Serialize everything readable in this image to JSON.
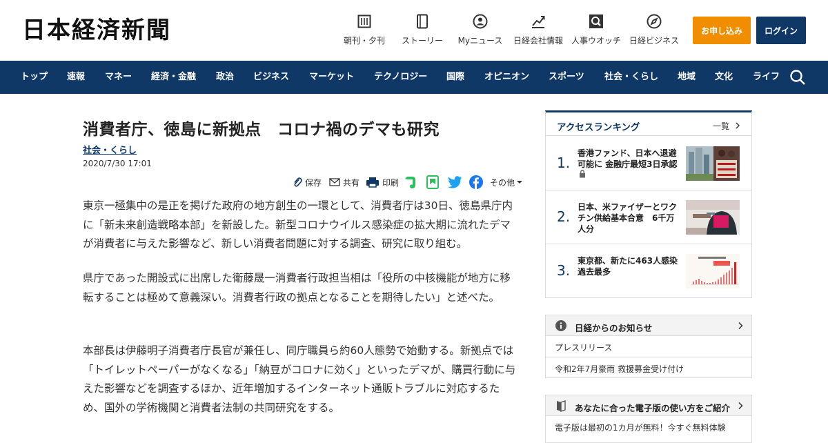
{
  "header": {
    "logo": "日本経済新聞",
    "utilities": [
      {
        "label": "朝刊・夕刊",
        "icon": "newspaper-icon"
      },
      {
        "label": "ストーリー",
        "icon": "book-icon"
      },
      {
        "label": "Myニュース",
        "icon": "user-icon"
      },
      {
        "label": "日経会社情報",
        "icon": "chart-icon"
      },
      {
        "label": "人事ウオッチ",
        "icon": "search-person-icon"
      },
      {
        "label": "日経ビジネス",
        "icon": "compass-icon"
      }
    ],
    "apply_label": "お申し込み",
    "login_label": "ログイン"
  },
  "nav": {
    "items": [
      "トップ",
      "速報",
      "マネー",
      "経済・金融",
      "政治",
      "ビジネス",
      "マーケット",
      "テクノロジー",
      "国際",
      "オピニオン",
      "スポーツ",
      "社会・くらし",
      "地域",
      "文化",
      "ライフ"
    ]
  },
  "article": {
    "title": "消費者庁、徳島に新拠点　コロナ禍のデマも研究",
    "category": "社会・くらし",
    "date": "2020/7/30 17:01",
    "share": {
      "save": "保存",
      "share": "共有",
      "print": "印刷",
      "other": "その他"
    },
    "paragraphs": [
      "東京一極集中の是正を掲げた政府の地方創生の一環として、消費者庁は30日、徳島県庁内に「新未来創造戦略本部」を新設した。新型コロナウイルス感染症の拡大期に流れたデマが消費者に与えた影響など、新しい消費者問題に対する調査、研究に取り組む。",
      "県庁であった開設式に出席した衛藤晟一消費者行政担当相は「役所の中核機能が地方に移転することは極めて意義深い。消費者行政の拠点となることを期待したい」と述べた。",
      "本部長は伊藤明子消費者庁長官が兼任し、同庁職員ら約60人態勢で始動する。新拠点では「トイレットペーパーがなくなる」「納豆がコロナに効く」といったデマが、購買行動に与えた影響などを調査するほか、近年増加するインターネット通販トラブルに対応するため、国外の学術機関と消費者法制の共同研究をする。"
    ]
  },
  "sidebar": {
    "ranking": {
      "title": "アクセスランキング",
      "more": "一覧",
      "items": [
        {
          "rank": "1.",
          "text": "香港ファンド、日本へ退避可能に 金融庁最短3日承認"
        },
        {
          "rank": "2.",
          "text": "日本、米ファイザーとワクチン供給基本合意　6千万人分"
        },
        {
          "rank": "3.",
          "text": "東京都、新たに463人感染　過去最多"
        }
      ]
    },
    "notice": {
      "title": "日経からのお知らせ",
      "items": [
        "プレスリリース",
        "令和2年7月豪雨 救援募金受け付け"
      ]
    },
    "guide": {
      "title": "あなたに合った電子版の使い方をご紹介",
      "text": "電子版は最初の1カ月が無料！今すぐ無料体験"
    }
  },
  "colors": {
    "navy": "#0f3866",
    "orange": "#f18e00"
  }
}
